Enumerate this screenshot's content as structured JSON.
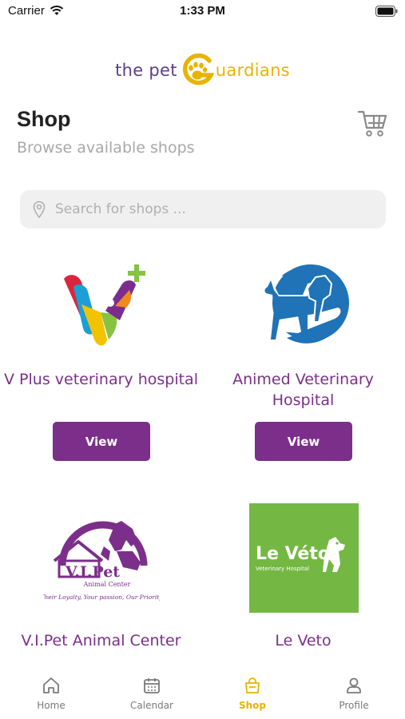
{
  "status_bar": {
    "carrier": "Carrier",
    "time": "1:33 PM"
  },
  "logo": {
    "part1": "the pet ",
    "part2": "uardians"
  },
  "header": {
    "title": "Shop",
    "subtitle": "Browse available shops"
  },
  "search": {
    "placeholder": "Search for shops ...",
    "value": ""
  },
  "colors": {
    "accent": "#7b2f8a",
    "active_tab": "#e6b400",
    "logo_purple": "#5d3f8a",
    "logo_yellow": "#e8b400"
  },
  "shops": [
    {
      "name": "V Plus veterinary hospital",
      "view_label": "View",
      "logo_icon": "v-plus-logo"
    },
    {
      "name": "Animed Veterinary Hospital",
      "view_label": "View",
      "logo_icon": "animed-logo"
    },
    {
      "name": "V.I.Pet Animal Center",
      "logo_icon": "vipet-logo",
      "logo_text": {
        "title": "V.I.Pet",
        "sub": "Animal Center",
        "tagline": "Their Loyalty, Your passion, Our Priority"
      }
    },
    {
      "name": "Le Veto",
      "logo_icon": "le-veto-logo",
      "logo_text": {
        "title": "Le Véto",
        "sub": "Veterinary Hospital"
      }
    }
  ],
  "tabs": [
    {
      "label": "Home",
      "icon": "home-icon"
    },
    {
      "label": "Calendar",
      "icon": "calendar-icon"
    },
    {
      "label": "Shop",
      "icon": "shop-bag-icon",
      "active": true
    },
    {
      "label": "Profile",
      "icon": "profile-icon"
    }
  ]
}
